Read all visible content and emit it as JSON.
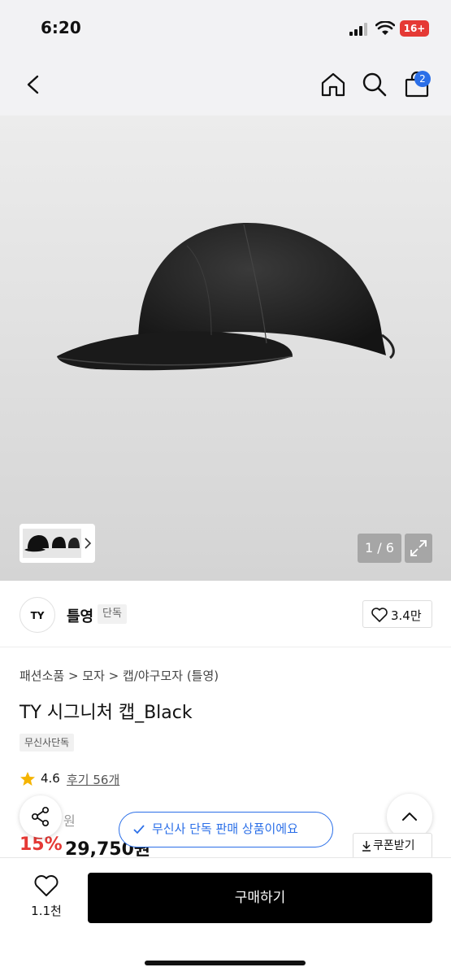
{
  "status_bar": {
    "time": "6:20",
    "battery": "16+"
  },
  "nav": {
    "cart_count": "2"
  },
  "gallery": {
    "counter": "1 / 6"
  },
  "brand": {
    "logo_text": "TY",
    "name": "틀영",
    "tag": "단독",
    "likes": "3.4만"
  },
  "product": {
    "breadcrumb": "패션소품 > 모자 > 캡/야구모자 (틀영)",
    "title": "TY 시그니처 캡_Black",
    "badge": "무신사단독",
    "rating": "4.6",
    "review_link": "후기 56개",
    "original_price_suffix": "원",
    "discount": "15%",
    "sale_price": "29,750원"
  },
  "toast": {
    "text": "무신사 단독 판매 상품이에요"
  },
  "coupon": {
    "label": "쿠폰받기"
  },
  "bottom": {
    "wish_count": "1.1천",
    "buy_label": "구매하기"
  },
  "colors": {
    "accent_blue": "#2b6fe8",
    "discount_red": "#e53935"
  }
}
